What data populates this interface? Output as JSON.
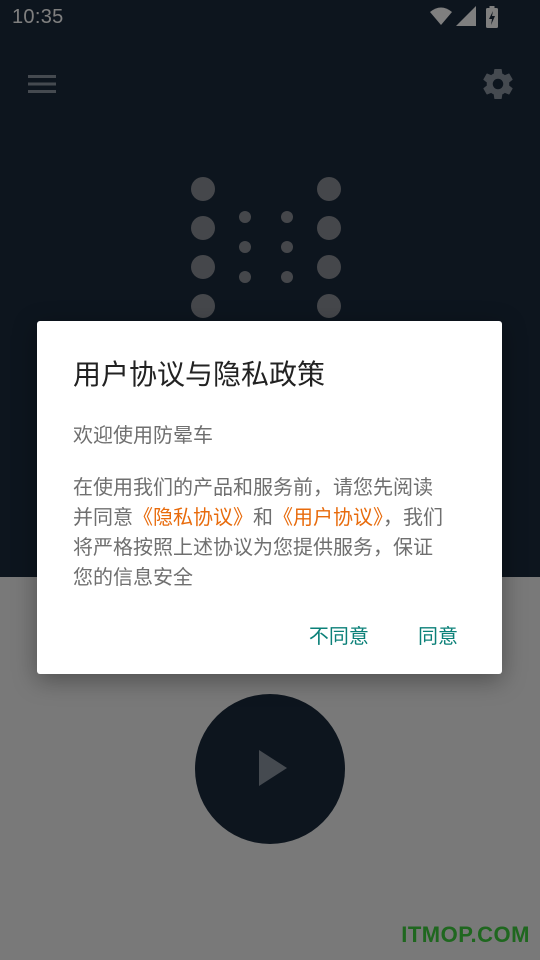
{
  "status_bar": {
    "time": "10:35",
    "icons": [
      "wifi-icon",
      "signal-icon",
      "battery-charging-icon"
    ]
  },
  "toolbar": {
    "menu_icon": "hamburger-menu-icon",
    "settings_icon": "gear-icon"
  },
  "main": {
    "play_icon": "play-icon"
  },
  "dialog": {
    "title": "用户协议与隐私政策",
    "welcome": "欢迎使用防晕车",
    "body": {
      "line1": "在使用我们的产品和服务前，请您先阅读",
      "line2_prefix": "并同意",
      "privacy_link": "《隐私协议》",
      "line2_mid": "和",
      "user_link": "《用户协议》",
      "line2_suffix": "，我们",
      "line3": "将严格按照上述协议为您提供服务，保证",
      "line4": "您的信息安全"
    },
    "disagree_label": "不同意",
    "agree_label": "同意"
  },
  "watermark": "ITMOP.COM",
  "colors": {
    "app_dark": "#1b2a3d",
    "link_orange": "#e86b0c",
    "button_teal": "#0b8078",
    "logo_dots": "#8b8f96"
  }
}
